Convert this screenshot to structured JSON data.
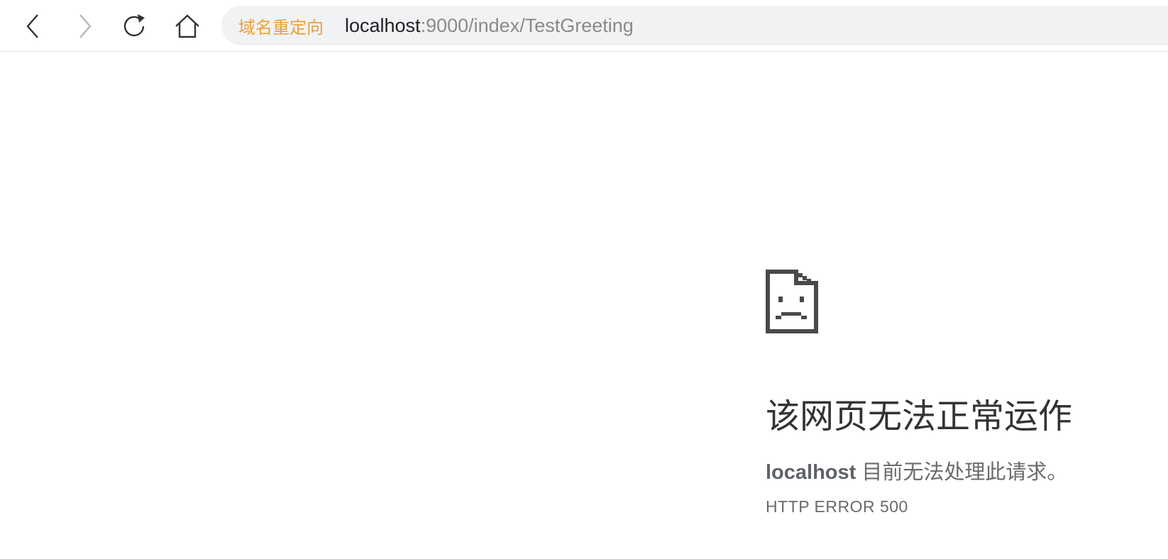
{
  "toolbar": {
    "back_icon": "chevron-left-icon",
    "forward_icon": "chevron-right-icon",
    "reload_icon": "reload-icon",
    "home_icon": "home-icon",
    "forward_enabled": false
  },
  "address_bar": {
    "redirect_label": "域名重定向",
    "url_host": "localhost",
    "url_path": ":9000/index/TestGreeting",
    "redirect_color": "#e8a13a"
  },
  "error_page": {
    "icon": "sad-document-icon",
    "title": "该网页无法正常运作",
    "host": "localhost",
    "message": " 目前无法处理此请求。",
    "error_code": "HTTP ERROR 500"
  }
}
